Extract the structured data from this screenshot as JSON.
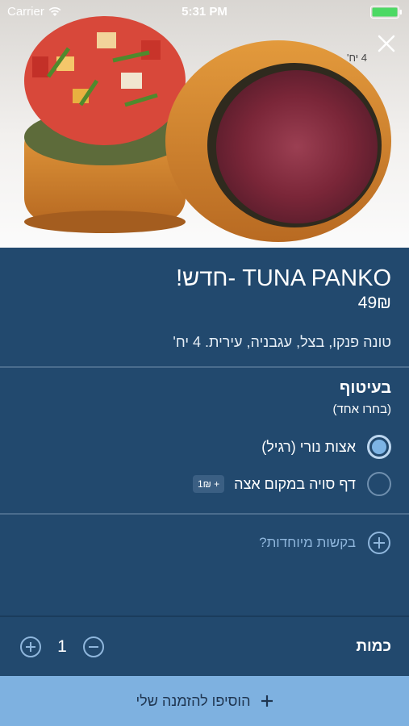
{
  "status_bar": {
    "carrier": "Carrier",
    "time": "5:31 PM"
  },
  "hero": {
    "pieces_tag": "4 יח'"
  },
  "product": {
    "title": "TUNA PANKO -חדש!",
    "price": "49₪",
    "description": "טונה פנקו, בצל, עגבניה, עירית. 4 יח'"
  },
  "option_group": {
    "title": "בעיטוף",
    "subtitle": "(בחרו אחד)",
    "options": [
      {
        "label": "אצות נורי (רגיל)",
        "selected": true,
        "price": ""
      },
      {
        "label": "דף סויה במקום אצה",
        "selected": false,
        "price": "+ 1₪"
      }
    ]
  },
  "special_requests": {
    "label": "בקשות מיוחדות?"
  },
  "quantity": {
    "label": "כמות",
    "value": "1"
  },
  "add_button": {
    "label": "הוסיפו להזמנה שלי"
  },
  "colors": {
    "background": "#22496e",
    "accent": "#7eb1e0",
    "radio_fill": "#7db4e5"
  }
}
